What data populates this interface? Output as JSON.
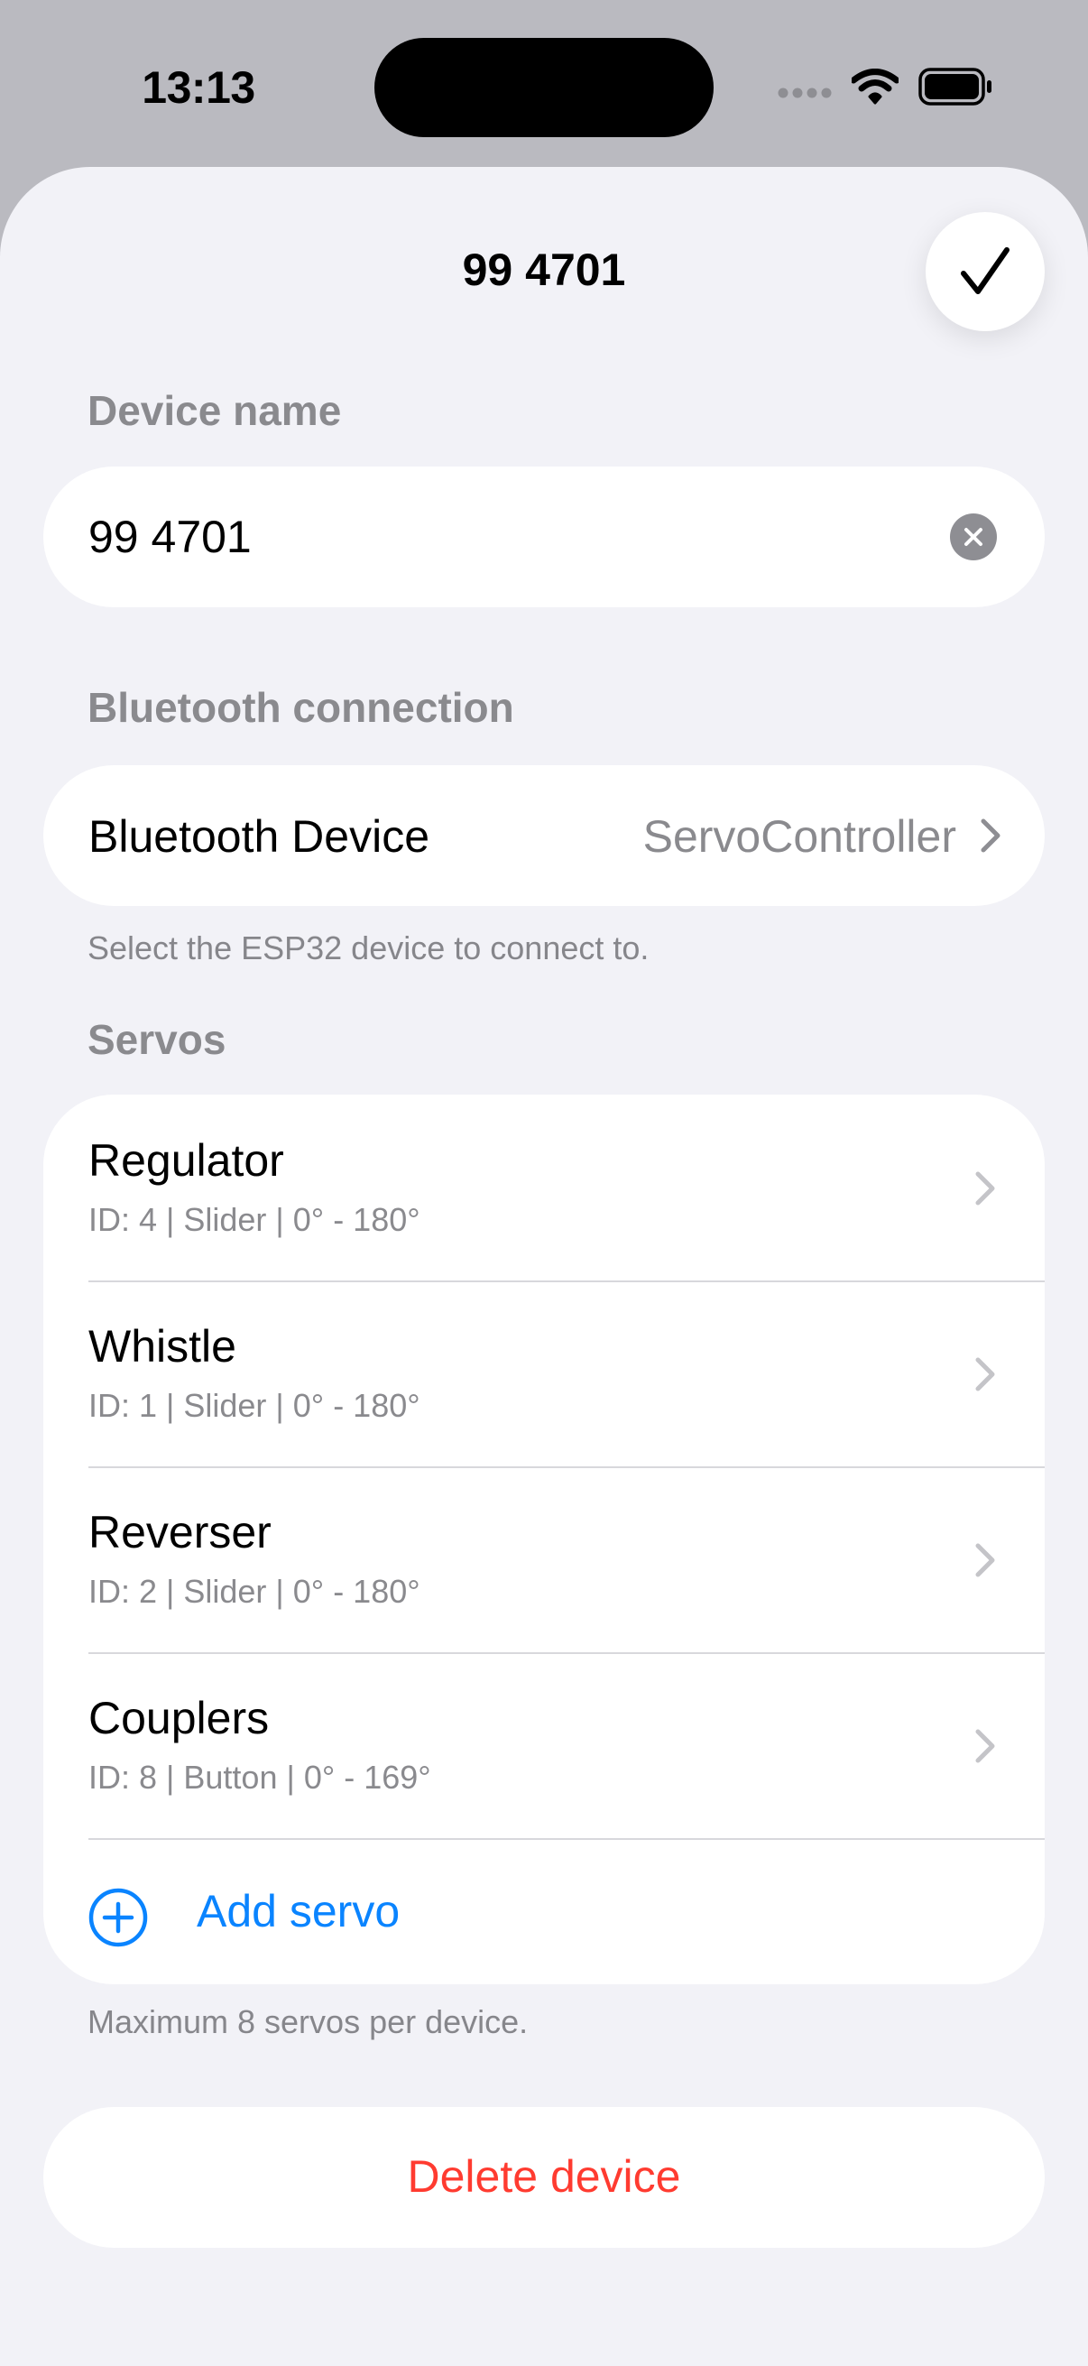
{
  "status_bar": {
    "time": "13:13",
    "icons": [
      "cellular-dots-icon",
      "wifi-icon",
      "battery-icon"
    ]
  },
  "nav": {
    "title": "99 4701",
    "done_icon": "checkmark-icon"
  },
  "device_name": {
    "section_label": "Device name",
    "value": "99 4701"
  },
  "bluetooth": {
    "section_label": "Bluetooth connection",
    "row_label": "Bluetooth Device",
    "row_value": "ServoController",
    "footnote": "Select the ESP32 device to connect to."
  },
  "servos": {
    "section_label": "Servos",
    "items": [
      {
        "name": "Regulator",
        "detail": "ID: 4 | Slider | 0° - 180°"
      },
      {
        "name": "Whistle",
        "detail": "ID: 1 | Slider | 0° - 180°"
      },
      {
        "name": "Reverser",
        "detail": "ID: 2 | Slider | 0° - 180°"
      },
      {
        "name": "Couplers",
        "detail": "ID: 8 | Button | 0° - 169°"
      }
    ],
    "add_label": "Add servo",
    "footnote": "Maximum 8 servos per device."
  },
  "delete": {
    "label": "Delete device"
  },
  "colors": {
    "accent": "#0a84ff",
    "destructive": "#ff3b30",
    "sheet_background": "#f2f2f7",
    "secondary_text": "#8a8a8e"
  }
}
